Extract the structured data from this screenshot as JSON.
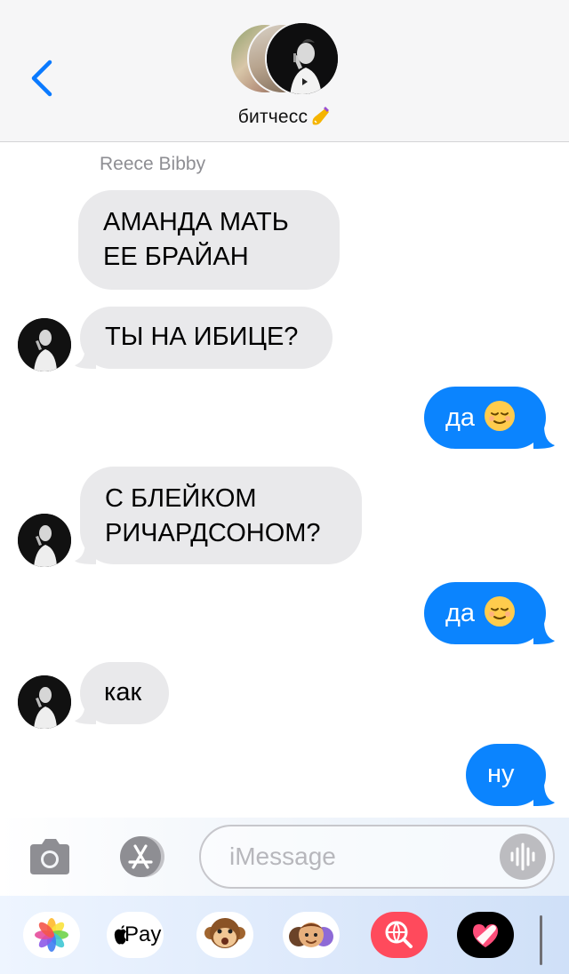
{
  "header": {
    "back_label": "",
    "group_name": "битчесс"
  },
  "chat": {
    "sender_name": "Reece Bibby",
    "messages": [
      {
        "direction": "in",
        "text": "АМАНДА МАТЬ ЕЕ БРАЙАН"
      },
      {
        "direction": "in",
        "text": "ТЫ НА ИБИЦЕ?"
      },
      {
        "direction": "out",
        "text": "да",
        "emoji": "relieved-face"
      },
      {
        "direction": "in",
        "text": "С БЛЕЙКОМ РИЧАРДСОНОМ?"
      },
      {
        "direction": "out",
        "text": "да",
        "emoji": "relieved-face"
      },
      {
        "direction": "in",
        "text": "как"
      },
      {
        "direction": "out",
        "text": "ну"
      }
    ]
  },
  "input_bar": {
    "placeholder": "iMessage",
    "icons": [
      "camera-icon",
      "app-store-icon",
      "audio-waveform-icon"
    ]
  },
  "app_drawer": {
    "apps": [
      {
        "name": "Photos",
        "icon": "photos-icon"
      },
      {
        "name": "Apple Pay",
        "label": "Pay",
        "icon": "apple-pay-icon"
      },
      {
        "name": "Animoji",
        "icon": "monkey-animoji-icon"
      },
      {
        "name": "Memoji Stickers",
        "icon": "memoji-icon"
      },
      {
        "name": "Images Search",
        "icon": "globe-search-icon"
      },
      {
        "name": "Digital Touch",
        "icon": "digital-touch-heart-icon"
      }
    ]
  },
  "colors": {
    "outgoing_bubble": "#0b84fe",
    "incoming_bubble": "#e9e9eb",
    "header_bg": "#f6f6f7",
    "accent": "#0a7aff"
  }
}
